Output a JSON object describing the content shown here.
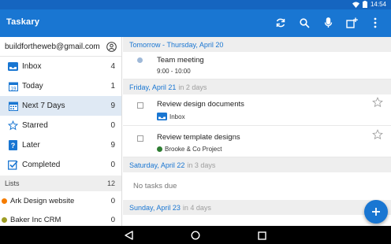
{
  "status_bar": {
    "time": "14:54"
  },
  "app_bar": {
    "title": "Taskary",
    "actions": [
      "sync-icon",
      "search-icon",
      "mic-icon",
      "add-list-icon",
      "more-icon"
    ]
  },
  "sidebar": {
    "account_email": "buildfortheweb@gmail.com",
    "nav": [
      {
        "label": "Inbox",
        "count": "4",
        "icon": "inbox-icon"
      },
      {
        "label": "Today",
        "count": "1",
        "icon": "calendar-today-icon"
      },
      {
        "label": "Next 7 Days",
        "count": "9",
        "icon": "calendar-week-icon",
        "active": true
      },
      {
        "label": "Starred",
        "count": "0",
        "icon": "star-icon"
      },
      {
        "label": "Later",
        "count": "9",
        "icon": "later-icon"
      },
      {
        "label": "Completed",
        "count": "0",
        "icon": "check-icon"
      }
    ],
    "lists_header": {
      "label": "Lists",
      "count": "12"
    },
    "lists": [
      {
        "label": "Ark Design website",
        "count": "0",
        "color": "#f57c00"
      },
      {
        "label": "Baker Inc CRM",
        "count": "0",
        "color": "#9e9d24"
      }
    ]
  },
  "main": {
    "sections": [
      {
        "date": "Tomorrow",
        "sep": " - ",
        "day": "Thursday, April 20",
        "rel": ""
      },
      {
        "date": "Friday, April 21",
        "rel": "in 2 days"
      },
      {
        "date": "Saturday, April 22",
        "rel": "in 3 days"
      },
      {
        "date": "Sunday, April 23",
        "rel": "in 4 days"
      }
    ],
    "tasks": [
      {
        "name": "Team meeting",
        "sub": "9:00 - 10:00"
      },
      {
        "name": "Review design documents",
        "sub": "Inbox"
      },
      {
        "name": "Review template designs",
        "sub": "Brooke & Co Project",
        "sub_color": "#2e7d32"
      }
    ],
    "no_tasks": "No tasks due"
  },
  "colors": {
    "primary": "#1976d2",
    "status_bar": "#1565c0",
    "active_row": "#dfe9f4"
  }
}
